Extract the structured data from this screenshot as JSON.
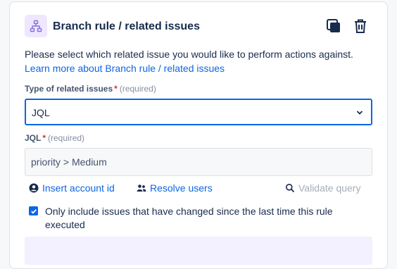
{
  "header": {
    "title": "Branch rule / related issues",
    "icon": "branch-rule-icon",
    "accent_color": "#8270db"
  },
  "description": {
    "text": "Please select which related issue you would like to perform actions against.",
    "link_text": "Learn more about Branch rule / related issues"
  },
  "related_issues_field": {
    "label": "Type of related issues",
    "required_text": "(required)",
    "selected_value": "JQL"
  },
  "jql_field": {
    "label": "JQL",
    "required_text": "(required)",
    "value": "priority > Medium"
  },
  "actions": {
    "insert_account_id": "Insert account id",
    "resolve_users": "Resolve users",
    "validate_query": "Validate query"
  },
  "option": {
    "checked": true,
    "label": "Only include issues that have changed since the last time this rule executed"
  },
  "colors": {
    "link": "#0c66e4",
    "required_star": "#c9372c"
  }
}
